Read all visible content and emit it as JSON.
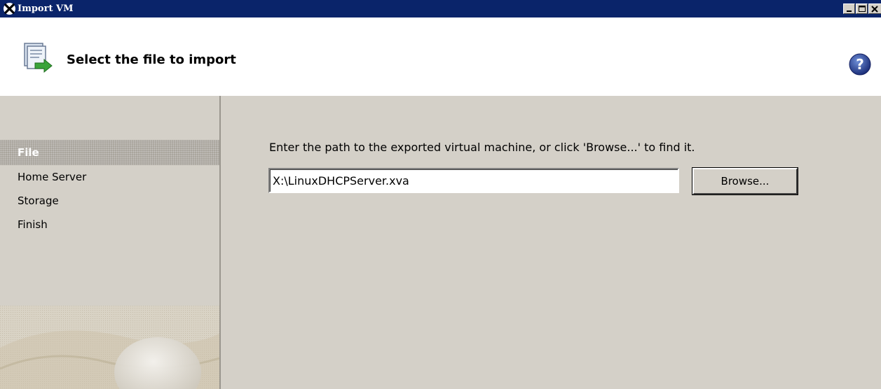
{
  "window": {
    "title": "Import VM",
    "controls": {
      "minimize_icon": "minimize-icon",
      "maximize_icon": "maximize-icon",
      "close_icon": "close-icon"
    }
  },
  "header": {
    "title": "Select the file to import",
    "icon": "import-file-icon",
    "help_icon": "help-icon"
  },
  "sidebar": {
    "steps": [
      {
        "label": "File",
        "active": true
      },
      {
        "label": "Home Server",
        "active": false
      },
      {
        "label": "Storage",
        "active": false
      },
      {
        "label": "Finish",
        "active": false
      }
    ]
  },
  "main": {
    "instruction": "Enter the path to the exported virtual machine, or click 'Browse...' to find it.",
    "path_value": "X:\\LinuxDHCPServer.xva",
    "browse_label": "Browse..."
  },
  "colors": {
    "titlebar": "#0a246a",
    "panel": "#d4d0c8",
    "header_bg": "#ffffff",
    "active_step": "#a9a59d"
  }
}
